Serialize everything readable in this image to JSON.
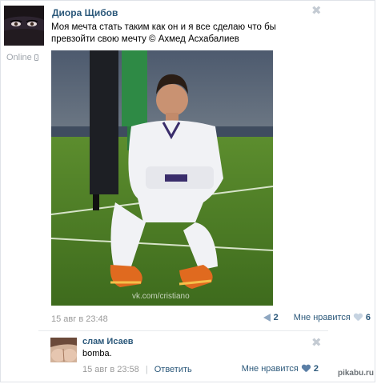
{
  "post": {
    "author": "Диора Щибов",
    "status": "Online",
    "text": "Моя мечта стать таким как он и я все сделаю что бы превзойти свою мечту © Ахмед Асхабалиев",
    "photo_watermark": "vk.com/cristiano",
    "date": "15 авг в 23:48",
    "shares": "2",
    "like_label": "Мне нравится",
    "likes": "6",
    "close_label": "✖"
  },
  "comment": {
    "author": "слам Исаев",
    "text": "bomba.",
    "date": "15 авг в 23:58",
    "separator": "|",
    "reply_label": "Ответить",
    "like_label": "Мне нравится",
    "likes": "2",
    "close_label": "✖"
  },
  "site_watermark": "pikabu.ru",
  "colors": {
    "link": "#2b587a",
    "muted": "#999999",
    "close": "#c4cbd3"
  }
}
